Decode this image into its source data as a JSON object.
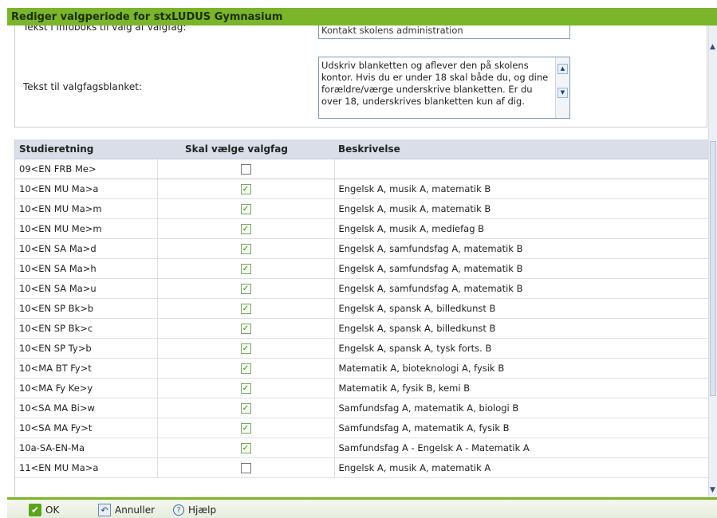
{
  "dialog": {
    "title": "Rediger valgperiode for stxLUDUS Gymnasium"
  },
  "form": {
    "infobox_label": "Tekst i infoboks til valg af valgfag:",
    "infobox_value": "Kontakt skolens administration",
    "blanket_label": "Tekst til valgfagsblanket:",
    "blanket_value": "Udskriv blanketten og aflever den på skolens kontor. Hvis du er under 18 skal både du, og dine forældre/værge underskrive blanketten. Er du over 18, underskrives blanketten kun af dig."
  },
  "table": {
    "headers": [
      "Studieretning",
      "Skal vælge valgfag",
      "Beskrivelse"
    ],
    "rows": [
      {
        "studieretning": "09<EN FRB Me>",
        "checked": false,
        "beskrivelse": ""
      },
      {
        "studieretning": "10<EN MU Ma>a",
        "checked": true,
        "beskrivelse": "Engelsk A, musik A, matematik B"
      },
      {
        "studieretning": "10<EN MU Ma>m",
        "checked": true,
        "beskrivelse": "Engelsk A, musik A, matematik B"
      },
      {
        "studieretning": "10<EN MU Me>m",
        "checked": true,
        "beskrivelse": "Engelsk A, musik A, mediefag B"
      },
      {
        "studieretning": "10<EN SA Ma>d",
        "checked": true,
        "beskrivelse": "Engelsk A, samfundsfag A, matematik B"
      },
      {
        "studieretning": "10<EN SA Ma>h",
        "checked": true,
        "beskrivelse": "Engelsk A, samfundsfag A, matematik B"
      },
      {
        "studieretning": "10<EN SA Ma>u",
        "checked": true,
        "beskrivelse": "Engelsk A, samfundsfag A, matematik B"
      },
      {
        "studieretning": "10<EN SP Bk>b",
        "checked": true,
        "beskrivelse": "Engelsk A, spansk A, billedkunst B"
      },
      {
        "studieretning": "10<EN SP Bk>c",
        "checked": true,
        "beskrivelse": "Engelsk A, spansk A, billedkunst B"
      },
      {
        "studieretning": "10<EN SP Ty>b",
        "checked": true,
        "beskrivelse": "Engelsk A, spansk A, tysk forts. B"
      },
      {
        "studieretning": "10<MA BT Fy>t",
        "checked": true,
        "beskrivelse": "Matematik A, bioteknologi A, fysik B"
      },
      {
        "studieretning": "10<MA Fy Ke>y",
        "checked": true,
        "beskrivelse": "Matematik A, fysik B, kemi B"
      },
      {
        "studieretning": "10<SA MA Bi>w",
        "checked": true,
        "beskrivelse": "Samfundsfag A, matematik A, biologi B"
      },
      {
        "studieretning": "10<SA MA Fy>t",
        "checked": true,
        "beskrivelse": "Samfundsfag A, matematik A, fysik B"
      },
      {
        "studieretning": "10a-SA-EN-Ma",
        "checked": true,
        "beskrivelse": "Samfundsfag A - Engelsk A - Matematik A"
      },
      {
        "studieretning": "11<EN MU Ma>a",
        "checked": false,
        "beskrivelse": "Engelsk A, musik A, matematik A"
      }
    ]
  },
  "footer": {
    "ok_label": "OK",
    "cancel_label": "Annuller",
    "help_label": "Hjælp"
  },
  "colors": {
    "accent": "#7ab52a",
    "header_bg": "#d9dee8"
  }
}
